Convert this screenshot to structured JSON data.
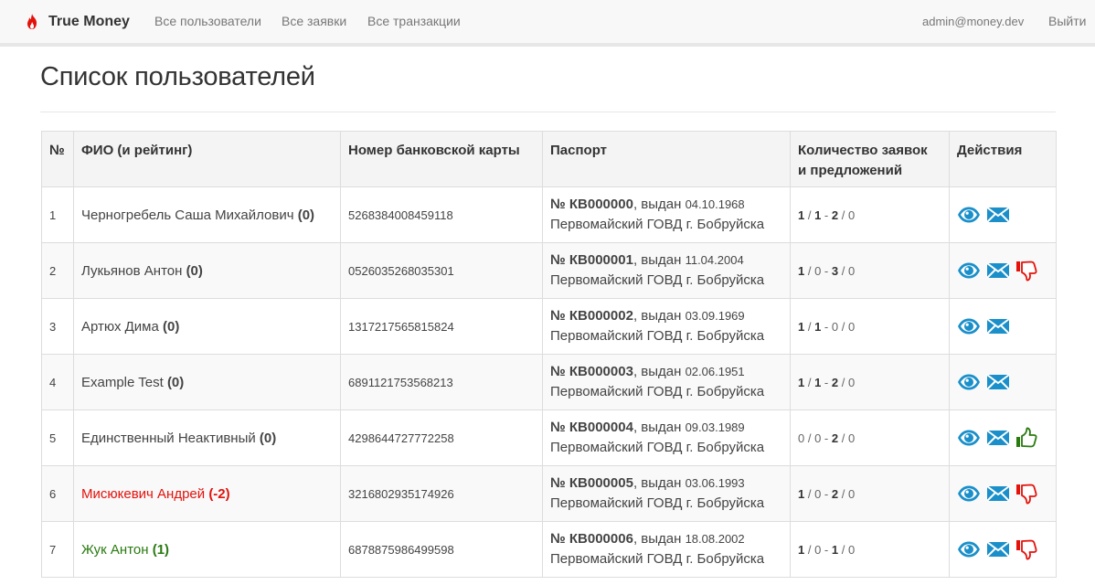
{
  "navbar": {
    "brand": "True Money",
    "links": [
      "Все пользователи",
      "Все заявки",
      "Все транзакции"
    ],
    "email": "admin@money.dev",
    "logout": "Выйти"
  },
  "page": {
    "title": "Список пользователей"
  },
  "table": {
    "headers": {
      "num": "№",
      "name": "ФИО (и рейтинг)",
      "card": "Номер банковской карты",
      "passport": "Паспорт",
      "counts_line1": "Количество заявок",
      "counts_line2": "и предложений",
      "actions": "Действия"
    },
    "rows": [
      {
        "num": "1",
        "name": "Черногребель Саша Михайлович",
        "rating": "(0)",
        "status": "normal",
        "card": "5268384008459118",
        "passport_no": "№ КВ000000",
        "passport_issued": ", выдан ",
        "passport_date": "04.10.1968",
        "passport_org": "Первомайский ГОВД г. Бобруйска",
        "c1": "1",
        "c2": "1",
        "c3": "2",
        "c4": "0",
        "c1b": true,
        "c2b": true,
        "c3b": true,
        "c4b": false,
        "vote": "none"
      },
      {
        "num": "2",
        "name": "Лукьянов Антон",
        "rating": "(0)",
        "status": "normal",
        "card": "0526035268035301",
        "passport_no": "№ КВ000001",
        "passport_issued": ", выдан ",
        "passport_date": "11.04.2004",
        "passport_org": "Первомайский ГОВД г. Бобруйска",
        "c1": "1",
        "c2": "0",
        "c3": "3",
        "c4": "0",
        "c1b": true,
        "c2b": false,
        "c3b": true,
        "c4b": false,
        "vote": "down"
      },
      {
        "num": "3",
        "name": "Артюх Дима",
        "rating": "(0)",
        "status": "normal",
        "card": "1317217565815824",
        "passport_no": "№ КВ000002",
        "passport_issued": ", выдан ",
        "passport_date": "03.09.1969",
        "passport_org": "Первомайский ГОВД г. Бобруйска",
        "c1": "1",
        "c2": "1",
        "c3": "0",
        "c4": "0",
        "c1b": true,
        "c2b": true,
        "c3b": false,
        "c4b": false,
        "vote": "none"
      },
      {
        "num": "4",
        "name": "Example Test",
        "rating": "(0)",
        "status": "normal",
        "card": "6891121753568213",
        "passport_no": "№ КВ000003",
        "passport_issued": ", выдан ",
        "passport_date": "02.06.1951",
        "passport_org": "Первомайский ГОВД г. Бобруйска",
        "c1": "1",
        "c2": "1",
        "c3": "2",
        "c4": "0",
        "c1b": true,
        "c2b": true,
        "c3b": true,
        "c4b": false,
        "vote": "none"
      },
      {
        "num": "5",
        "name": "Единственный Неактивный",
        "rating": "(0)",
        "status": "normal",
        "card": "4298644727772258",
        "passport_no": "№ КВ000004",
        "passport_issued": ", выдан ",
        "passport_date": "09.03.1989",
        "passport_org": "Первомайский ГОВД г. Бобруйска",
        "c1": "0",
        "c2": "0",
        "c3": "2",
        "c4": "0",
        "c1b": false,
        "c2b": false,
        "c3b": true,
        "c4b": false,
        "vote": "up"
      },
      {
        "num": "6",
        "name": "Мисюкевич Андрей",
        "rating": "(-2)",
        "status": "negative",
        "card": "3216802935174926",
        "passport_no": "№ КВ000005",
        "passport_issued": ", выдан ",
        "passport_date": "03.06.1993",
        "passport_org": "Первомайский ГОВД г. Бобруйска",
        "c1": "1",
        "c2": "0",
        "c3": "2",
        "c4": "0",
        "c1b": true,
        "c2b": false,
        "c3b": true,
        "c4b": false,
        "vote": "down"
      },
      {
        "num": "7",
        "name": "Жук Антон",
        "rating": "(1)",
        "status": "positive",
        "card": "6878875986499598",
        "passport_no": "№ КВ000006",
        "passport_issued": ", выдан ",
        "passport_date": "18.08.2002",
        "passport_org": "Первомайский ГОВД г. Бобруйска",
        "c1": "1",
        "c2": "0",
        "c3": "1",
        "c4": "0",
        "c1b": true,
        "c2b": false,
        "c3b": true,
        "c4b": false,
        "vote": "down"
      }
    ]
  },
  "icons": {
    "view": "eye-icon",
    "message": "envelope-icon",
    "thumbs_down": "thumbs-down-icon",
    "thumbs_up": "thumbs-up-icon"
  },
  "colors": {
    "link_blue": "#1a8fc9",
    "danger_red": "#e3120b",
    "success_green": "#2a7a10",
    "brand_red": "#e3120b"
  }
}
